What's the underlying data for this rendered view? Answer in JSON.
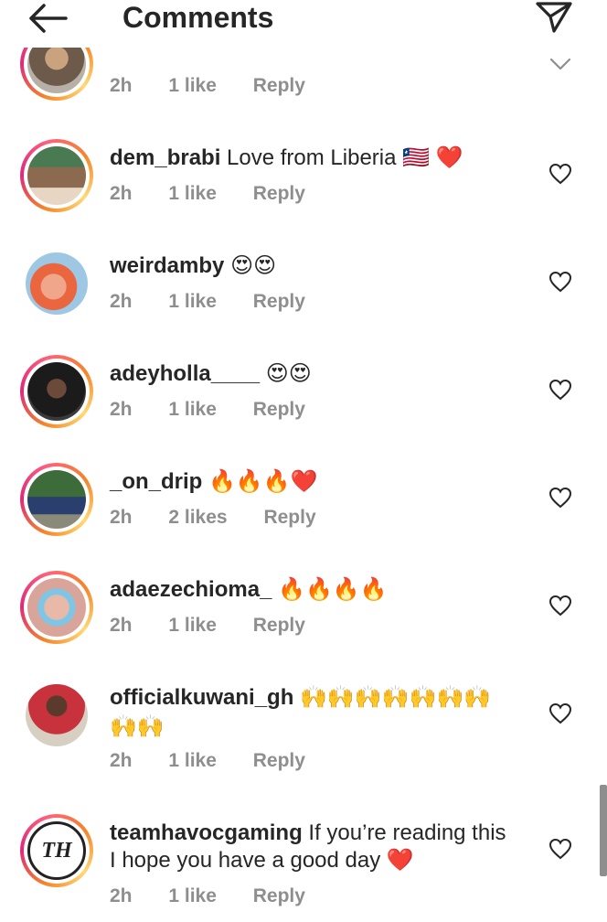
{
  "header": {
    "title": "Comments"
  },
  "comments": [
    {
      "username": "",
      "text": "",
      "time": "2h",
      "likes": "1 like",
      "reply": "Reply"
    },
    {
      "username": "dem_brabi",
      "text": "Love from Liberia 🇱🇷 ❤️",
      "time": "2h",
      "likes": "1 like",
      "reply": "Reply"
    },
    {
      "username": "weirdamby",
      "text": "😍😍",
      "time": "2h",
      "likes": "1 like",
      "reply": "Reply"
    },
    {
      "username": "adeyholla____",
      "text": "😍😍",
      "time": "2h",
      "likes": "1 like",
      "reply": "Reply"
    },
    {
      "username": "_on_drip",
      "text": "🔥🔥🔥❤️",
      "time": "2h",
      "likes": "2 likes",
      "reply": "Reply"
    },
    {
      "username": "adaezechioma_",
      "text": "🔥🔥🔥🔥",
      "time": "2h",
      "likes": "1 like",
      "reply": "Reply"
    },
    {
      "username": "officialkuwani_gh",
      "text": "🙌🙌🙌🙌🙌🙌🙌",
      "text2": "🙌🙌",
      "time": "2h",
      "likes": "1 like",
      "reply": "Reply"
    },
    {
      "username": "teamhavocgaming",
      "text": "If you’re reading this",
      "text2": "I hope you have a good day ❤️",
      "time": "2h",
      "likes": "1 like",
      "reply": "Reply",
      "avatar_text": "TH"
    }
  ],
  "colors": {
    "ring": "#dd2a7b",
    "muted": "#8e8e8e",
    "heart": "#e0245e"
  }
}
